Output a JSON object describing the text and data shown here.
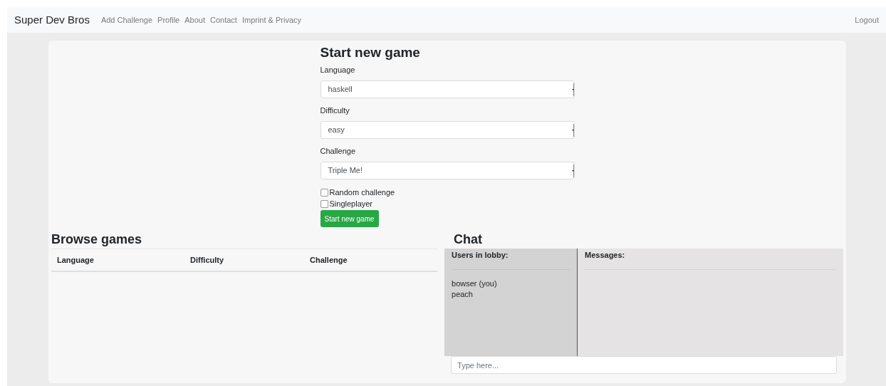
{
  "navbar": {
    "brand": "Super Dev Bros",
    "links": [
      "Add Challenge",
      "Profile",
      "About",
      "Contact",
      "Imprint & Privacy"
    ],
    "right_link": "Logout"
  },
  "new_game": {
    "title": "Start new game",
    "selects": [
      {
        "label": "Language",
        "value": "haskell"
      },
      {
        "label": "Difficulty",
        "value": "easy"
      },
      {
        "label": "Challenge",
        "value": "Triple Me!"
      }
    ],
    "checkboxes": [
      {
        "label": "Random challenge",
        "checked": false
      },
      {
        "label": "Singleplayer",
        "checked": false
      }
    ],
    "button": "Start new game"
  },
  "browse": {
    "title": "Browse games",
    "columns": [
      "Language",
      "Difficulty",
      "Challenge"
    ]
  },
  "chat": {
    "title": "Chat",
    "users_heading": "Users in lobby:",
    "users": [
      "bowser (you)",
      "peach"
    ],
    "messages_heading": "Messages:",
    "input": {
      "placeholder": "Type here..."
    }
  }
}
